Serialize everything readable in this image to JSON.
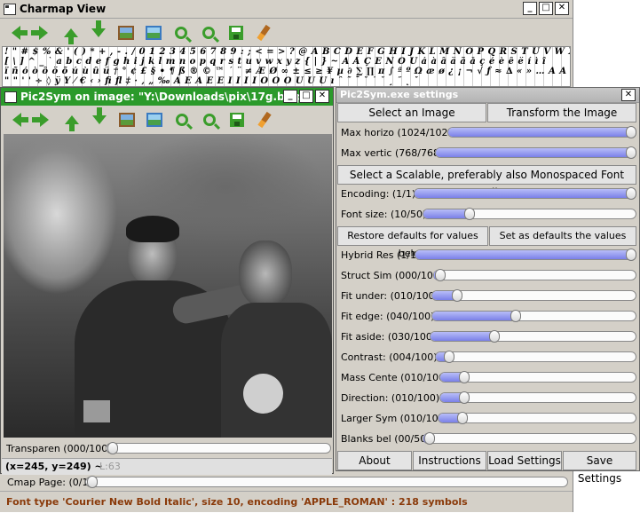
{
  "charmap": {
    "title": "Charmap View",
    "char_rows": [
      "! \" # $ % & ' ( ) * + , - . / 0 1 2 3 4 5 6 7 8 9 : ; < = > ? @ A B C D E F G H I J K L M N O P Q R S T U V W X Y Z",
      "[ \\ ] ^ _ ` a b c d e f g h i j k l m n o p q r s t u v w x y z { | } ~ Ä Å Ç É Ñ Ö Ü á à â ä ã å ç é è ê ë í ì î",
      "ï ñ ó ò ô ö õ ú ù û ü † ° ¢ £ § • ¶ ß ® © ™ ´ ¨ ≠ Æ Ø ∞ ± ≤ ≥ ¥ µ ∂ ∑ ∏ π ∫ ª º Ω æ ø ¿ ¡ ¬ √ ƒ ≈ ∆ « » … À Ã Õ Œ œ – —",
      "\" \" ' ' ÷ ◊ ÿ Ÿ ⁄ € ‹ › ﬁ ﬂ ‡ · ‚ „ ‰ Â Ê Á Ë È Í Î Ï Ì Ó Ô  Ò Ú Û Ù ı ˆ ˜ ¯ ˘ ˙ ˚ ¸ ˝ ˛ ˇ"
    ],
    "cmap_page_label": "Cmap Page: (0/1)",
    "status": "Font type 'Courier New Bold Italic', size 10, encoding 'APPLE_ROMAN' : 218 symbols"
  },
  "pic2sym": {
    "title": "Pic2Sym on image: \"Y:\\Downloads\\pix\\17g.bmp\"",
    "transparency_label": "Transparen (000/100)",
    "transparency": 0,
    "coords": "(x=245, y=249) ~",
    "luminance": "L:63"
  },
  "window_buttons": {
    "minimize": "_",
    "maximize": "□",
    "close": "✕"
  },
  "settings": {
    "title": "Pic2Sym.exe settings",
    "close": "✕",
    "select_image": "Select an Image",
    "transform_image": "Transform the Image",
    "select_font": "Select a Scalable, preferably also Monospaced Font Family",
    "restore_defaults": "Restore defaults for values below",
    "set_defaults": "Set as defaults the values below",
    "about": "About",
    "instructions": "Instructions",
    "load_settings": "Load Settings",
    "save_settings": "Save Settings",
    "sliders": [
      {
        "label": "Max horizo (1024/1024)",
        "value": 1024,
        "max": 1024
      },
      {
        "label": "Max vertic (768/768)",
        "value": 768,
        "max": 768
      },
      {
        "label": "Encoding:  (1/1)",
        "value": 1,
        "max": 1
      },
      {
        "label": "Font size:  (10/50)",
        "value": 10,
        "max": 50
      },
      {
        "label": "Hybrid Res (1/1)",
        "value": 1,
        "max": 1
      },
      {
        "label": "Struct Sim (000/100)",
        "value": 0,
        "max": 100
      },
      {
        "label": "Fit under:  (010/100)",
        "value": 10,
        "max": 100
      },
      {
        "label": "Fit edge:  (040/100)",
        "value": 40,
        "max": 100
      },
      {
        "label": "Fit aside:  (030/100)",
        "value": 30,
        "max": 100
      },
      {
        "label": "Contrast:  (004/100)",
        "value": 4,
        "max": 100
      },
      {
        "label": "Mass Cente (010/100)",
        "value": 10,
        "max": 100
      },
      {
        "label": "Direction:  (010/100)",
        "value": 10,
        "max": 100
      },
      {
        "label": "Larger Sym (010/100)",
        "value": 10,
        "max": 100
      },
      {
        "label": "Blanks bel (00/50)",
        "value": 0,
        "max": 50
      }
    ]
  },
  "colors": {
    "active_titlebar": "#2b9a2b",
    "slider_fill": "#8a90ee",
    "status_text": "#8a3a0a"
  }
}
